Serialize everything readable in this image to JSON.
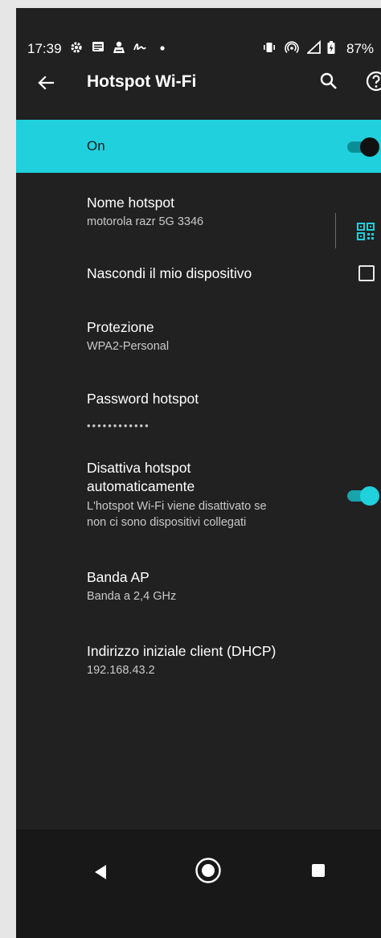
{
  "status_bar": {
    "time": "17:39",
    "battery": "87%",
    "icons": [
      "gear-icon",
      "notes-icon",
      "account-icon",
      "signature-icon",
      "dot-icon",
      "vibrate-icon",
      "hotspot-icon",
      "signal-icon",
      "battery-icon"
    ]
  },
  "app_bar": {
    "title": "Hotspot Wi-Fi"
  },
  "master_switch": {
    "label": "On",
    "state": true
  },
  "settings": {
    "hotspot_name": {
      "title": "Nome hotspot",
      "value": "motorola razr 5G 3346"
    },
    "hide_device": {
      "title": "Nascondi il mio dispositivo",
      "checked": false
    },
    "security": {
      "title": "Protezione",
      "value": "WPA2-Personal"
    },
    "password": {
      "title": "Password hotspot",
      "value": "••••••••••••"
    },
    "auto_off": {
      "title_line1": "Disattiva hotspot",
      "title_line2": "automaticamente",
      "summary_line1": "L'hotspot Wi-Fi viene disattivato se",
      "summary_line2": "non ci sono dispositivi collegati",
      "state": true
    },
    "ap_band": {
      "title": "Banda AP",
      "value": "Banda a 2,4 GHz"
    },
    "dhcp": {
      "title": "Indirizzo iniziale client (DHCP)",
      "value": "192.168.43.2"
    }
  },
  "colors": {
    "accent": "#20d0dc",
    "background": "#212121",
    "navbar": "#181818"
  }
}
